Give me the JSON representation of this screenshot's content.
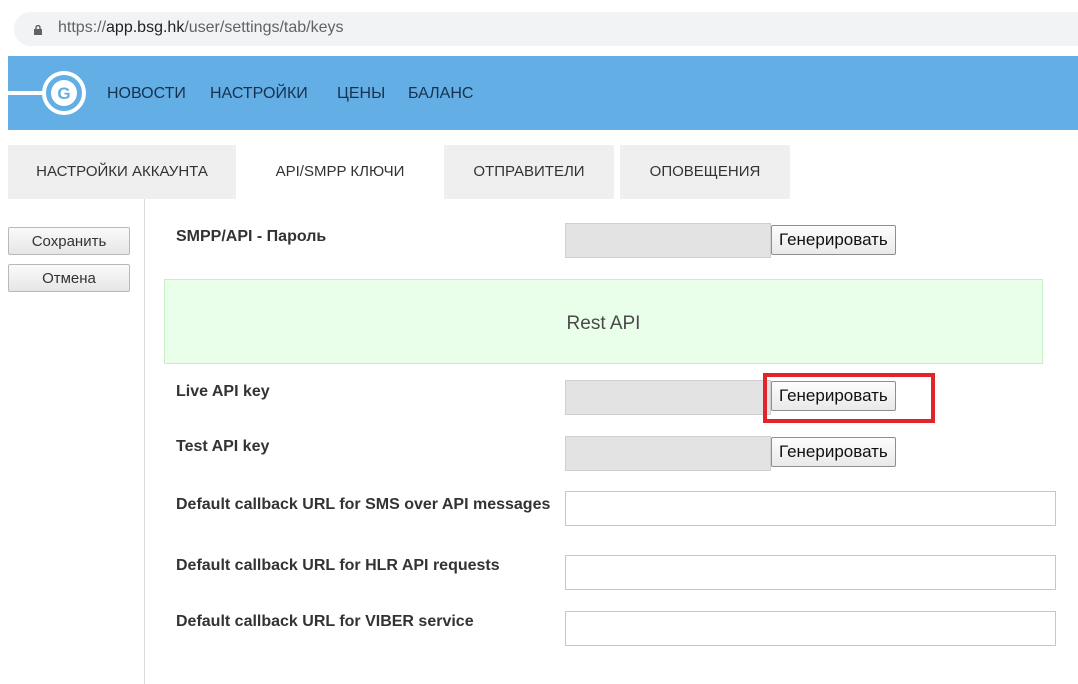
{
  "browser": {
    "url_scheme": "https://",
    "url_host": "app.bsg.hk",
    "url_path": "/user/settings/tab/keys"
  },
  "logo_letter": "G",
  "nav": {
    "items": [
      "НОВОСТИ",
      "НАСТРОЙКИ",
      "ЦЕНЫ",
      "БАЛАНС"
    ]
  },
  "tabs": [
    {
      "label": "НАСТРОЙКИ АККАУНТА",
      "active": false
    },
    {
      "label": "API/SMPP КЛЮЧИ",
      "active": true
    },
    {
      "label": "ОТПРАВИТЕЛИ",
      "active": false
    },
    {
      "label": "ОПОВЕЩЕНИЯ",
      "active": false
    }
  ],
  "sidebar": {
    "save_label": "Сохранить",
    "cancel_label": "Отмена"
  },
  "form": {
    "smpp_label": "SMPP/API - Пароль",
    "generate_label": "Генерировать",
    "rest_api_title": "Rest API",
    "live_key_label": "Live API key",
    "test_key_label": "Test API key",
    "sms_callback_label": "Default callback URL for SMS over API messages",
    "hlr_callback_label": "Default callback URL for HLR API requests",
    "viber_callback_label": "Default callback URL for VIBER service"
  },
  "colors": {
    "nav_bg": "#62aee5",
    "rest_api_bg": "#eaffea",
    "highlight": "#e3242b"
  }
}
